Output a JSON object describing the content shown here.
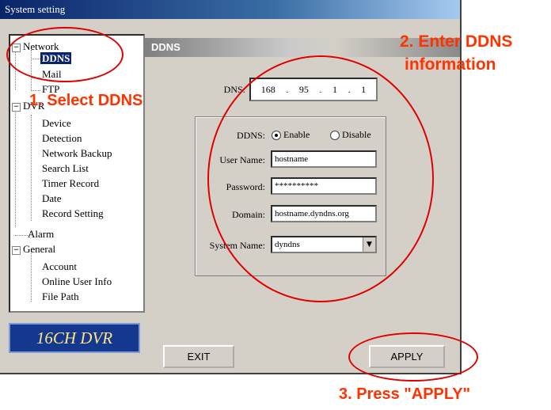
{
  "window": {
    "title": "System setting"
  },
  "tree": {
    "network": "Network",
    "ddns": "DDNS",
    "mail": "Mail",
    "ftp": "FTP",
    "dvr": "DVR",
    "device": "Device",
    "detection": "Detection",
    "network_backup": "Network Backup",
    "search_list": "Search List",
    "timer_record": "Timer Record",
    "date": "Date",
    "record_setting": "Record Setting",
    "alarm": "Alarm",
    "general": "General",
    "account": "Account",
    "online_user_info": "Online User Info",
    "file_path": "File Path"
  },
  "logo": "16CH DVR",
  "panel": {
    "header": "DDNS",
    "dns_label": "DNS:",
    "dns_ip": [
      "168",
      "95",
      "1",
      "1"
    ],
    "ddns_label": "DDNS:",
    "enable": "Enable",
    "disable": "Disable",
    "ddns_state": "enable",
    "username_label": "User Name:",
    "username": "hostname",
    "password_label": "Password:",
    "password": "**********",
    "domain_label": "Domain:",
    "domain": "hostname.dyndns.org",
    "system_name_label": "System Name:",
    "system_name": "dyndns"
  },
  "buttons": {
    "exit": "EXIT",
    "apply": "APPLY"
  },
  "annotations": {
    "step1": "1. Select DDNS",
    "step2_line1": "2. Enter DDNS",
    "step2_line2": "information",
    "step3": "3. Press \"APPLY\"",
    "color": "#ff3300",
    "circle_color": "#e00000"
  }
}
